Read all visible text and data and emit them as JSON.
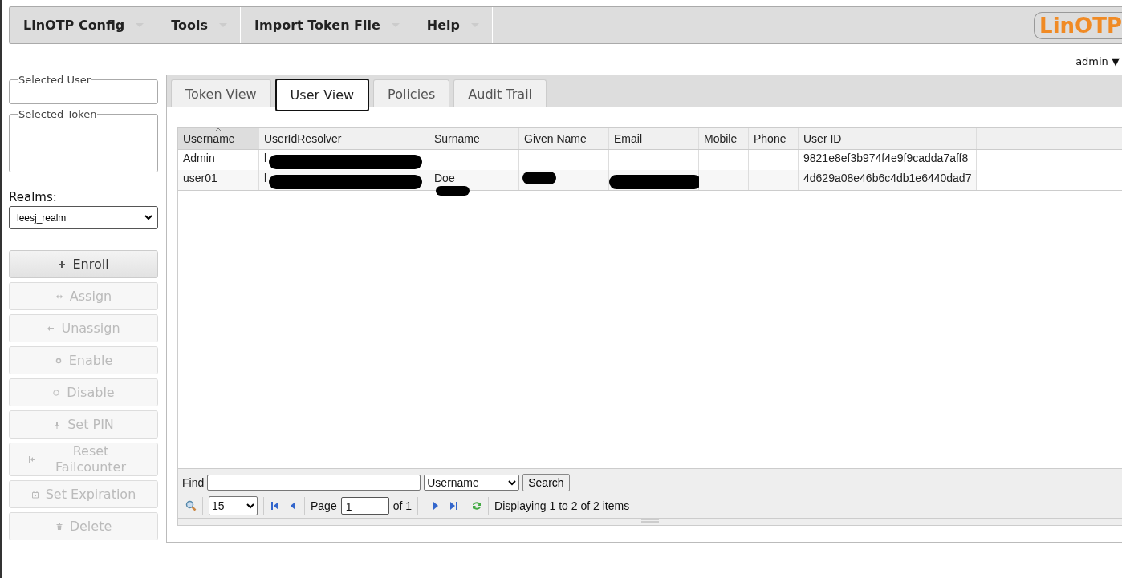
{
  "menu": [
    {
      "label": "LinOTP Config"
    },
    {
      "label": "Tools"
    },
    {
      "label": "Import Token File"
    },
    {
      "label": "Help"
    }
  ],
  "logo": "LinOTP",
  "user_menu": "admin ▼",
  "sidebar": {
    "selected_user": {
      "legend": "Selected User"
    },
    "selected_token": {
      "legend": "Selected Token"
    },
    "realms_label": "Realms:",
    "realm": "leesj_realm",
    "actions": [
      {
        "label": "Enroll",
        "disabled": false
      },
      {
        "label": "Assign",
        "disabled": true
      },
      {
        "label": "Unassign",
        "disabled": true
      },
      {
        "label": "Enable",
        "disabled": true
      },
      {
        "label": "Disable",
        "disabled": true
      },
      {
        "label": "Set PIN",
        "disabled": true
      },
      {
        "label": "Reset Failcounter",
        "disabled": true
      },
      {
        "label": "Set Expiration",
        "disabled": true
      },
      {
        "label": "Delete",
        "disabled": true
      }
    ]
  },
  "tabs": [
    {
      "label": "Token View",
      "selected": false
    },
    {
      "label": "User View",
      "selected": true
    },
    {
      "label": "Policies",
      "selected": false
    },
    {
      "label": "Audit Trail",
      "selected": false
    }
  ],
  "table": {
    "columns": [
      {
        "label": "Username",
        "sorted": true
      },
      {
        "label": "UserIdResolver",
        "sorted": false
      },
      {
        "label": "Surname",
        "sorted": false
      },
      {
        "label": "Given Name",
        "sorted": false
      },
      {
        "label": "Email",
        "sorted": false
      },
      {
        "label": "Mobile",
        "sorted": false
      },
      {
        "label": "Phone",
        "sorted": false
      },
      {
        "label": "User ID",
        "sorted": false
      }
    ],
    "rows": [
      {
        "cells": [
          {
            "text": "Admin"
          },
          {
            "text": "l",
            "redacted": true
          },
          {},
          {},
          {},
          {},
          {},
          {
            "text": "9821e8ef3b974f4e9f9cadda7aff8"
          }
        ]
      },
      {
        "cells": [
          {
            "text": "user01"
          },
          {
            "text": "l",
            "redacted": true
          },
          {
            "text": "Doe",
            "redacted": true
          },
          {
            "redacted": true
          },
          {
            "redacted": true
          },
          {},
          {},
          {
            "text": "4d629a08e46b6c4db1e6440dad7"
          }
        ]
      }
    ]
  },
  "footer": {
    "find_label": "Find",
    "search_field": "Username",
    "search_button": "Search",
    "page_size": "15",
    "page_label": "Page",
    "page": "1",
    "page_of": "of 1",
    "status": "Displaying 1 to 2 of 2 items"
  }
}
